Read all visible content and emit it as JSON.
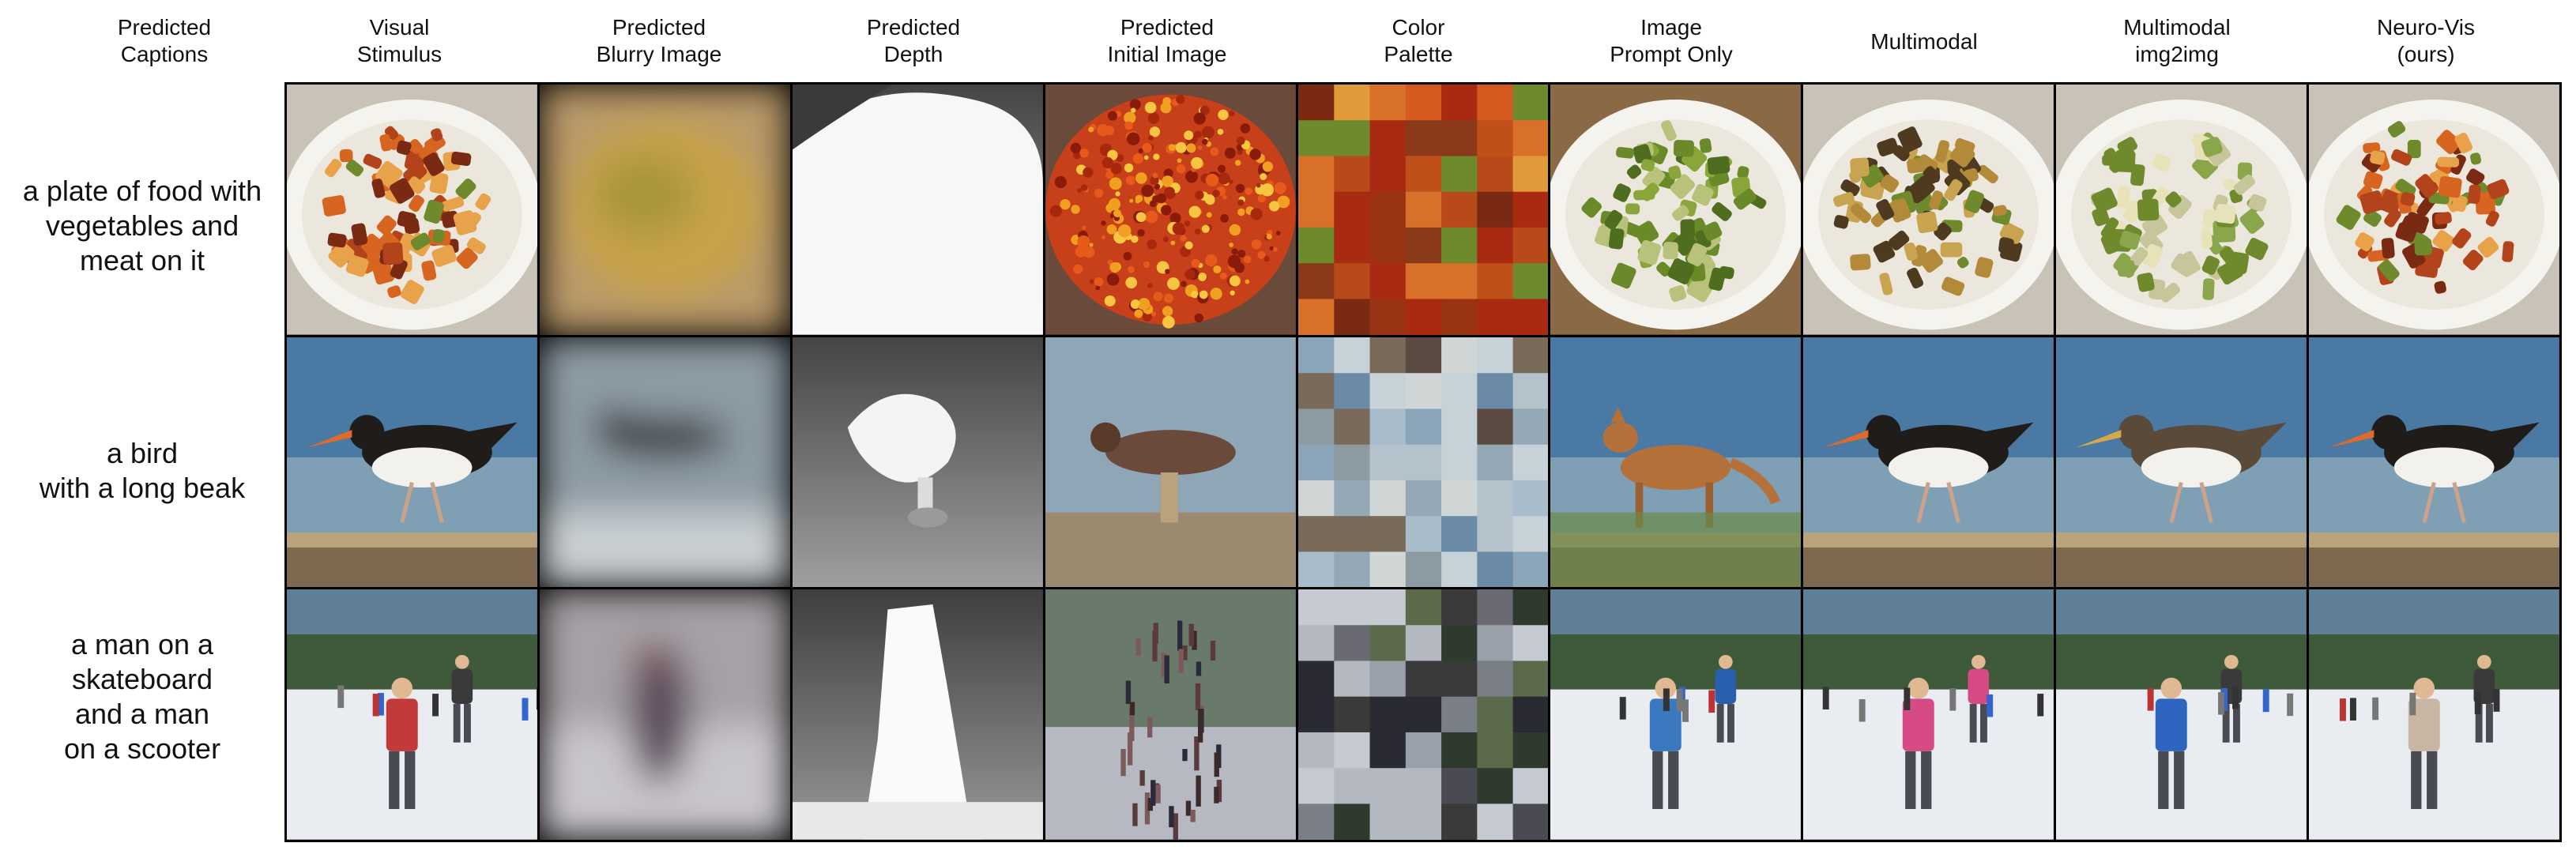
{
  "column_headers": [
    "Predicted\nCaptions",
    "Visual\nStimulus",
    "Predicted\nBlurry Image",
    "Predicted\nDepth",
    "Predicted\nInitial Image",
    "Color\nPalette",
    "Image\nPrompt Only",
    "Multimodal",
    "Multimodal\nimg2img",
    "Neuro-Vis\n(ours)"
  ],
  "rows": [
    {
      "caption": "a plate of food with\nvegetables and\nmeat on it",
      "subject": "food-plate"
    },
    {
      "caption": "a bird\nwith a long beak",
      "subject": "bird"
    },
    {
      "caption": "a man on a\nskateboard\nand a man\non a scooter",
      "subject": "people-snow"
    }
  ],
  "palette": {
    "food": [
      "#7a2a12",
      "#b3431a",
      "#d8651f",
      "#e8a24a",
      "#6e8a2c",
      "#f2efe8"
    ],
    "bird": [
      "#3f6f96",
      "#9ab4c8",
      "#c9d6dc",
      "#2a2421",
      "#f4f2ee",
      "#d4673a"
    ],
    "snow": [
      "#dfe4ec",
      "#f4f6f9",
      "#3a3b44",
      "#c43a3a",
      "#2b5fb1",
      "#7a7f87"
    ]
  }
}
